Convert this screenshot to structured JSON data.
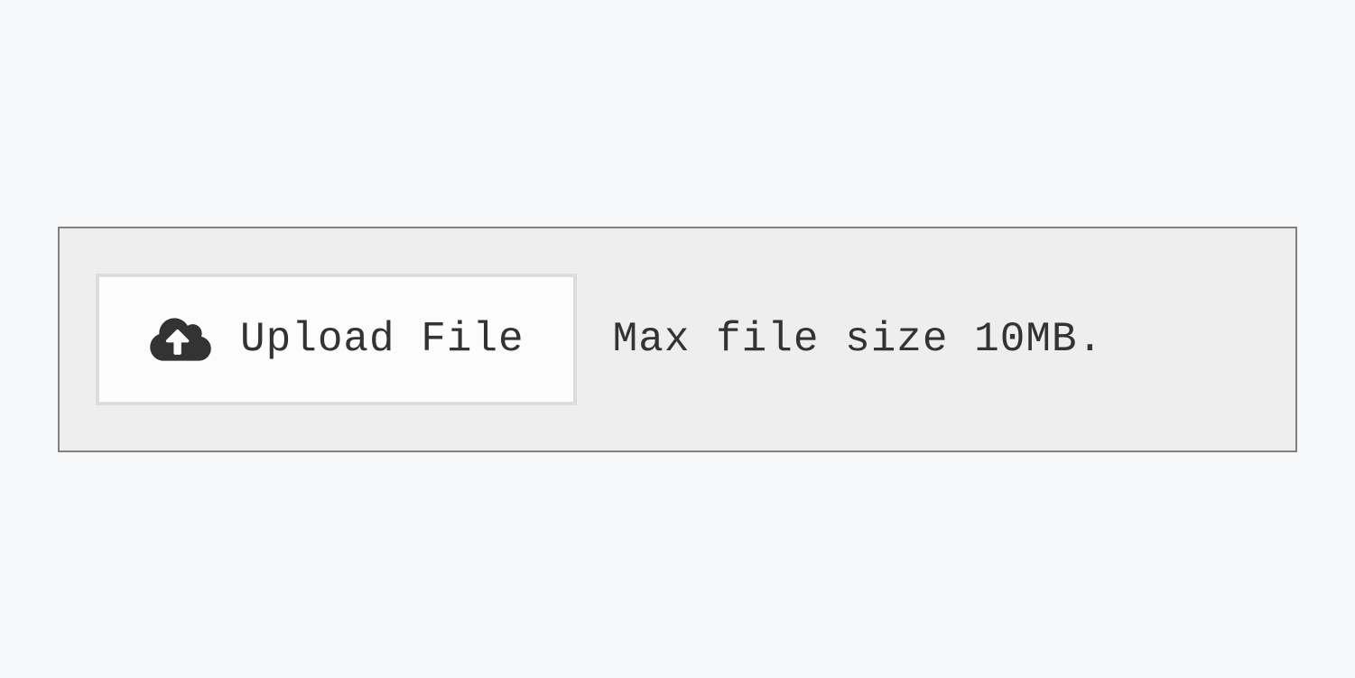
{
  "upload": {
    "button_label": "Upload File",
    "hint": "Max file size 10MB."
  }
}
